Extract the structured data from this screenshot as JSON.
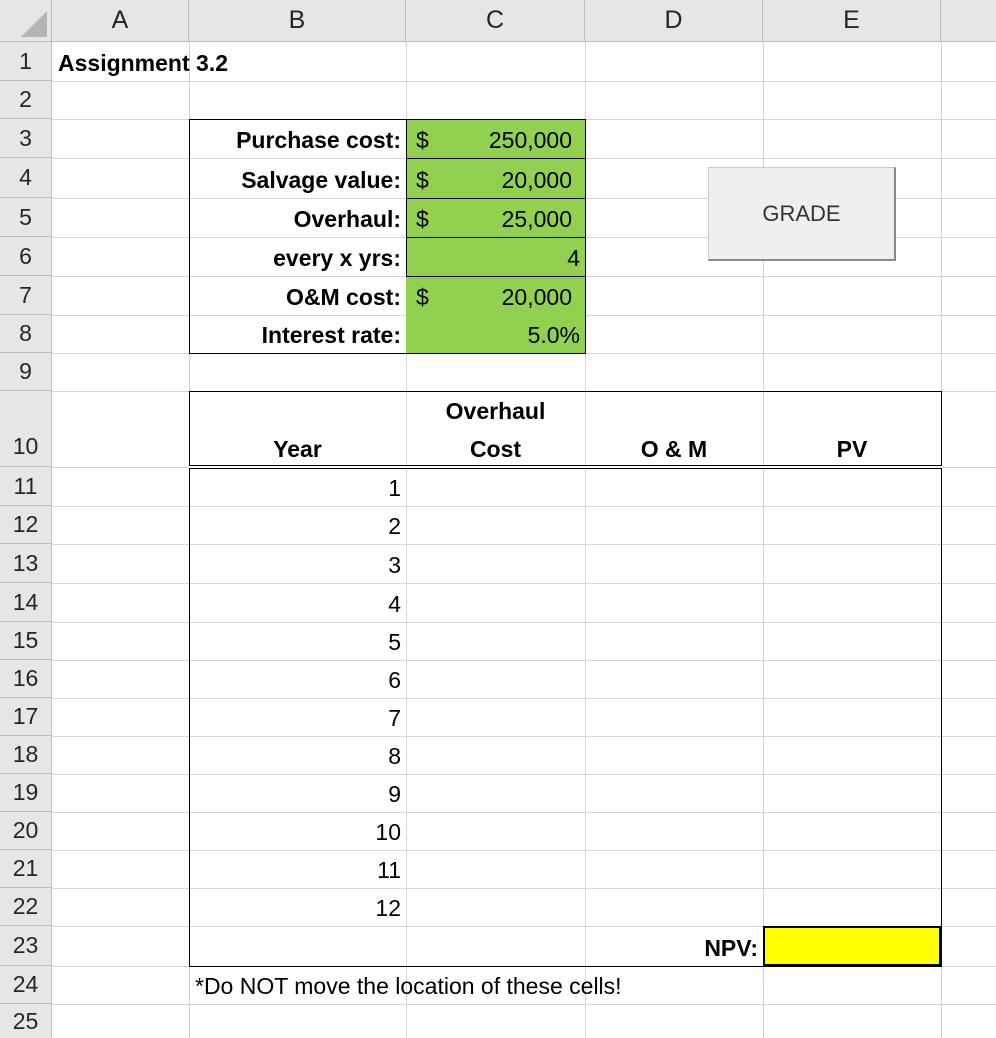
{
  "columns": [
    "A",
    "B",
    "C",
    "D",
    "E"
  ],
  "rows": [
    "1",
    "2",
    "3",
    "4",
    "5",
    "6",
    "7",
    "8",
    "9",
    "10",
    "11",
    "12",
    "13",
    "14",
    "15",
    "16",
    "17",
    "18",
    "19",
    "20",
    "21",
    "22",
    "23",
    "24",
    "25"
  ],
  "title": "Assignment 3.2",
  "inputs": {
    "purchase_label": "Purchase cost:",
    "purchase_currency": "$",
    "purchase_value": "250,000",
    "salvage_label": "Salvage value:",
    "salvage_currency": "$",
    "salvage_value": "20,000",
    "overhaul_label": "Overhaul:",
    "overhaul_currency": "$",
    "overhaul_value": "25,000",
    "every_label": "every x yrs:",
    "every_value": "4",
    "om_label": "O&M cost:",
    "om_currency": "$",
    "om_value": "20,000",
    "rate_label": "Interest rate:",
    "rate_value": "5.0%"
  },
  "grade_button": "GRADE",
  "table": {
    "hdr_year": "Year",
    "hdr_overhaul_1": "Overhaul",
    "hdr_overhaul_2": "Cost",
    "hdr_om": "O & M",
    "hdr_pv": "PV",
    "years": [
      "1",
      "2",
      "3",
      "4",
      "5",
      "6",
      "7",
      "8",
      "9",
      "10",
      "11",
      "12"
    ]
  },
  "npv_label": "NPV:",
  "npv_value": "",
  "note": "*Do NOT move the location of these cells!"
}
